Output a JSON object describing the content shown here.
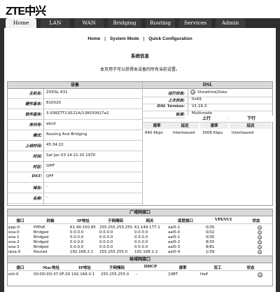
{
  "brand": {
    "logo_text": "ZTE中兴"
  },
  "tabs": [
    "Home",
    "LAN",
    "WAN",
    "Bridging",
    "Routing",
    "Services",
    "Admin"
  ],
  "subnav": {
    "items": [
      "Home",
      "System Mode",
      "Quick Configuration"
    ],
    "separator": "|"
  },
  "page": {
    "title": "系统信息",
    "description": "本页用于可以获得本设备的所有当前设置。"
  },
  "device": {
    "header": "设备",
    "rows": [
      {
        "label": "主机名:",
        "value": "ZXDSL 831"
      },
      {
        "label": "硬件版本:",
        "value": "810020"
      },
      {
        "label": "软件版本:",
        "value": "3.938ZTT2.8121A/138030917a2"
      },
      {
        "label": "序列号:",
        "value": "abcd"
      },
      {
        "label": "模式:",
        "value": "Routing And Bridging"
      },
      {
        "label": "上线时间:",
        "value": "45:34:22"
      },
      {
        "label": "时间:",
        "value": "Sat Jan 03 14:21:20 1970"
      },
      {
        "label": "时区:",
        "value": "GMT"
      },
      {
        "label": "DST:",
        "value": "OFF"
      },
      {
        "label": "域名:",
        "value": "-"
      },
      {
        "label": "名称:",
        "value": "-"
      }
    ]
  },
  "dsl": {
    "header": "DSL",
    "rows": [
      {
        "label": "运行状态:",
        "value": "Showtime/Data"
      },
      {
        "label": "上次状态:",
        "value": "0x69"
      },
      {
        "label": "DSL Version:",
        "value": "V1.16.3"
      },
      {
        "label": "标准:",
        "value": "Multimode"
      }
    ],
    "upstream": "上行",
    "downstream": "下行",
    "rate_label": "速率",
    "latency_label": "延迟",
    "up_rate": "640 Kbps",
    "up_latency": "Interleaved",
    "down_rate": "3008 Kbps",
    "down_latency": "Interleaved"
  },
  "wan": {
    "title": "广域网接口",
    "columns": [
      "接口",
      "封装",
      "IP地址",
      "子网掩码",
      "网关",
      "底层接口",
      "VPI/VCI",
      "状态"
    ],
    "rows": [
      [
        "ppp-0",
        "PPPoE",
        "61.49.150.85",
        "255.255.255.255",
        "61.149.177.1",
        "aal5-1",
        "0/35"
      ],
      [
        "eoa-0",
        "Bridged",
        "0.0.0.0",
        "0.0.0.0",
        "0.0.0.0",
        "aal5-0",
        "0/32"
      ],
      [
        "eoa-1",
        "Bridged",
        "0.0.0.0",
        "0.0.0.0",
        "0.0.0.0",
        "aal5-1",
        "0/35"
      ],
      [
        "eoa-2",
        "Bridged",
        "0.0.0.0",
        "0.0.0.0",
        "0.0.0.0",
        "aal5-2",
        "8/35"
      ],
      [
        "eoa-3",
        "Bridged",
        "0.0.0.0",
        "0.0.0.0",
        "0.0.0.0",
        "aal5-3",
        "8/81"
      ],
      [
        "ipoa-0",
        "Routed",
        "192.168.2.1",
        "255.255.255.0",
        "192.168.2.2",
        "aal5-4",
        "1/39"
      ]
    ]
  },
  "lan": {
    "title": "局域网接口",
    "columns": [
      "接口",
      "Mac地址",
      "IP地址",
      "子网掩码",
      "DHCP",
      "速率",
      "双工",
      "状态"
    ],
    "rows": [
      [
        "eth-0",
        "00:D0:D0:37:0F:29",
        "192.168.0.1",
        "255.255.255.0",
        "-",
        "10BT",
        "Half"
      ]
    ]
  },
  "colors": {
    "tab_bg": "#3c3c3c",
    "active_tab": "#f2f2f2",
    "header_bg": "#d9d9d9"
  }
}
